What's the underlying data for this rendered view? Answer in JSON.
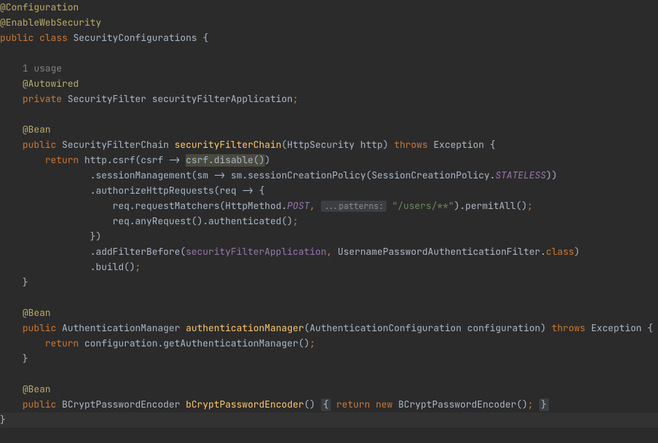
{
  "annotations": {
    "configuration": "@Configuration",
    "enableWebSecurity": "@EnableWebSecurity",
    "autowired": "@Autowired",
    "bean1": "@Bean",
    "bean2": "@Bean",
    "bean3": "@Bean"
  },
  "inlay": {
    "usage": "1 usage",
    "patternsLabel": "...patterns:"
  },
  "kw": {
    "public": "public",
    "class_": "class",
    "private": "private",
    "return_": "return",
    "throws_": "throws",
    "new_": "new",
    "classRef": "class"
  },
  "types": {
    "SecurityConfigurations": "SecurityConfigurations",
    "SecurityFilter": "SecurityFilter",
    "SecurityFilterChain": "SecurityFilterChain",
    "HttpSecurity": "HttpSecurity",
    "Exception": "Exception",
    "SessionCreationPolicy": "SessionCreationPolicy",
    "HttpMethod": "HttpMethod",
    "UsernamePasswordAuthenticationFilter": "UsernamePasswordAuthenticationFilter",
    "AuthenticationManager": "AuthenticationManager",
    "AuthenticationConfiguration": "AuthenticationConfiguration",
    "BCryptPasswordEncoder": "BCryptPasswordEncoder"
  },
  "methods": {
    "securityFilterChain": "securityFilterChain",
    "authenticationManager": "authenticationManager",
    "bCryptPasswordEncoder": "bCryptPasswordEncoder"
  },
  "idents": {
    "securityFilterApplicationDecl": "securityFilterApplication",
    "http": "http",
    "csrfVar": "csrf",
    "sm": "sm",
    "req": "req",
    "configuration": "configuration"
  },
  "calls": {
    "csrfM": "csrf",
    "disable": "disable",
    "sessionManagement": "sessionManagement",
    "sessionCreationPolicy": "sessionCreationPolicy",
    "authorizeHttpRequests": "authorizeHttpRequests",
    "requestMatchers": "requestMatchers",
    "permitAll": "permitAll",
    "anyRequest": "anyRequest",
    "authenticated": "authenticated",
    "addFilterBefore": "addFilterBefore",
    "build": "build",
    "getAuthenticationManager": "getAuthenticationManager"
  },
  "consts": {
    "STATELESS": "STATELESS",
    "POST": "POST"
  },
  "fieldRef": {
    "securityFilterApplication": "securityFilterApplication"
  },
  "strings": {
    "usersPattern": "\"/users/**\""
  },
  "punct": {
    "obrace": "{",
    "cbrace": "}",
    "oparen": "(",
    "cparen": ")",
    "dot": ".",
    "comma": ",",
    "arrow": "->",
    "semi": ";",
    "dparen": "))",
    "foldOBrace": "{",
    "foldCBrace": "}",
    "emptyParen": "()",
    "cbraceParen": "})"
  }
}
